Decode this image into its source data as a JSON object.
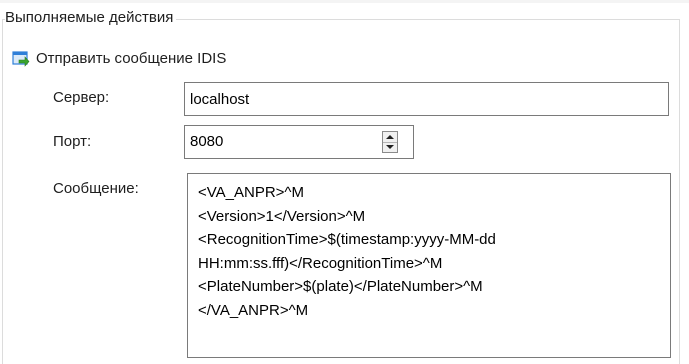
{
  "group": {
    "title": "Выполняемые действия"
  },
  "action": {
    "icon": "send-message-icon",
    "title": "Отправить сообщение IDIS"
  },
  "fields": {
    "server_label": "Сервер:",
    "server_value": "localhost",
    "port_label": "Порт:",
    "port_value": "8080",
    "message_label": "Сообщение:",
    "message_lines": [
      "<VA_ANPR>^M",
      "<Version>1</Version>^M",
      "<RecognitionTime>$(timestamp:yyyy-MM-dd",
      "HH:mm:ss.fff)</RecognitionTime>^M",
      "<PlateNumber>$(plate)</PlateNumber>^M",
      "</VA_ANPR>^M"
    ]
  },
  "colors": {
    "border": "#7a7a7a",
    "group_border": "#dcdcdc",
    "icon_blue": "#2f7fd8",
    "icon_green": "#3aa52d"
  }
}
